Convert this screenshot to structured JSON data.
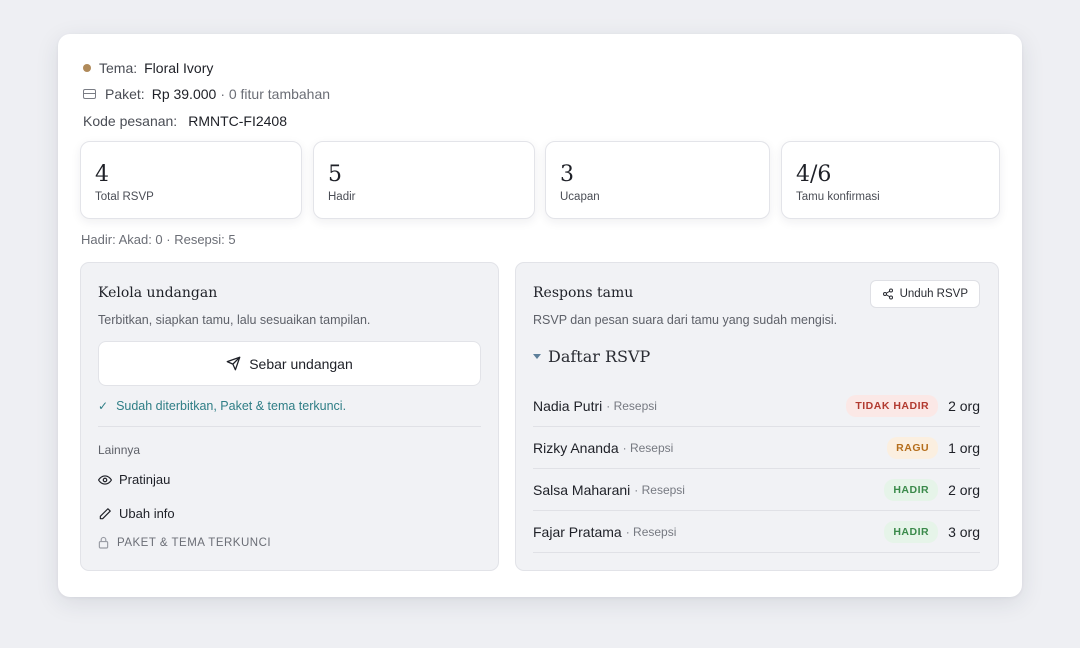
{
  "summary": {
    "theme_label": "Tema:",
    "theme_value": "Floral Ivory",
    "package_label": "Paket:",
    "package_price": "Rp 39.000",
    "package_extra": "· 0 fitur tambahan",
    "order_label": "Kode pesanan:",
    "order_code": "RMNTC-FI2408"
  },
  "stats": [
    {
      "value": "4",
      "label": "Total RSVP"
    },
    {
      "value": "5",
      "label": "Hadir"
    },
    {
      "value": "3",
      "label": "Ucapan"
    },
    {
      "value": "4/6",
      "label": "Tamu konfirmasi"
    }
  ],
  "attendance_note": "Hadir: Akad: 0 · Resepsi: 5",
  "manage": {
    "title": "Kelola undangan",
    "description": "Terbitkan, siapkan tamu, lalu sesuaikan tampilan.",
    "share_button": "Sebar undangan",
    "status": "Sudah diterbitkan, Paket & tema terkunci.",
    "others_label": "Lainnya",
    "preview": "Pratinjau",
    "edit_info": "Ubah info",
    "locked": "PAKET & TEMA TERKUNCI"
  },
  "responses": {
    "title": "Respons tamu",
    "description": "RSVP dan pesan suara dari tamu yang sudah mengisi.",
    "download_button": "Unduh RSVP",
    "list_title": "Daftar RSVP",
    "rows": [
      {
        "name": "Nadia Putri",
        "type": "· Resepsi",
        "status": "TIDAK HADIR",
        "count": "2 org"
      },
      {
        "name": "Rizky Ananda",
        "type": "· Resepsi",
        "status": "RAGU",
        "count": "1 org"
      },
      {
        "name": "Salsa Maharani",
        "type": "· Resepsi",
        "status": "HADIR",
        "count": "2 org"
      },
      {
        "name": "Fajar Pratama",
        "type": "· Resepsi",
        "status": "HADIR",
        "count": "3 org"
      }
    ]
  },
  "colors": {
    "accent_teal": "#2f7e86",
    "theme_dot": "#b08a5a",
    "absent": "#b23a30",
    "maybe": "#b56e1c",
    "present": "#3b8a4b"
  }
}
